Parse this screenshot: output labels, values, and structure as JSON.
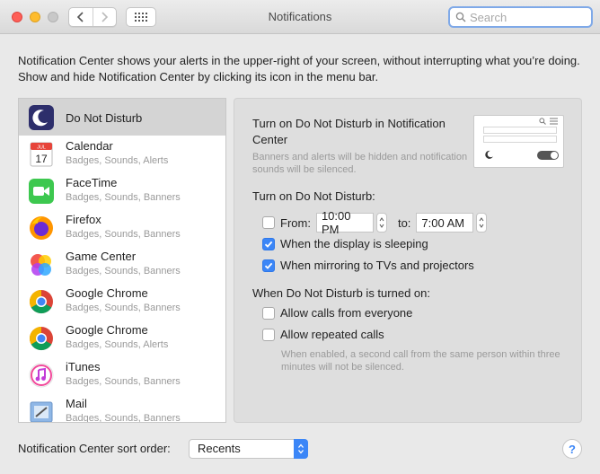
{
  "window": {
    "title": "Notifications"
  },
  "toolbar": {
    "search_placeholder": "Search",
    "search_value": ""
  },
  "description": "Notification Center shows your alerts in the upper-right of your screen, without interrupting what you’re doing. Show and hide Notification Center by clicking its icon in the menu bar.",
  "apps": [
    {
      "name": "Do Not Disturb",
      "sub": "",
      "icon": "moon-icon"
    },
    {
      "name": "Calendar",
      "sub": "Badges, Sounds, Alerts",
      "icon": "calendar-icon"
    },
    {
      "name": "FaceTime",
      "sub": "Badges, Sounds, Banners",
      "icon": "facetime-icon"
    },
    {
      "name": "Firefox",
      "sub": "Badges, Sounds, Banners",
      "icon": "firefox-icon"
    },
    {
      "name": "Game Center",
      "sub": "Badges, Sounds, Banners",
      "icon": "game-center-icon"
    },
    {
      "name": "Google Chrome",
      "sub": "Badges, Sounds, Banners",
      "icon": "chrome-icon"
    },
    {
      "name": "Google Chrome",
      "sub": "Badges, Sounds, Alerts",
      "icon": "chrome-icon"
    },
    {
      "name": "iTunes",
      "sub": "Badges, Sounds, Banners",
      "icon": "itunes-icon"
    },
    {
      "name": "Mail",
      "sub": "Badges, Sounds, Banners",
      "icon": "mail-icon"
    }
  ],
  "calendar_icon": {
    "month": "JUL",
    "day": "17"
  },
  "dnd": {
    "heading": "Turn on Do Not Disturb in Notification Center",
    "note": "Banners and alerts will be hidden and notification sounds will be silenced.",
    "turn_on_label": "Turn on Do Not Disturb:",
    "from_label": "From:",
    "from_value": "10:00 PM",
    "to_label": "to:",
    "to_value": "7:00 AM",
    "from_checked": false,
    "display_sleeping_label": "When the display is sleeping",
    "display_sleeping_checked": true,
    "mirroring_label": "When mirroring to TVs and projectors",
    "mirroring_checked": true,
    "when_on_label": "When Do Not Disturb is turned on:",
    "allow_calls_label": "Allow calls from everyone",
    "allow_calls_checked": false,
    "repeated_calls_label": "Allow repeated calls",
    "repeated_calls_checked": false,
    "repeated_note": "When enabled, a second call from the same person within three minutes will not be silenced."
  },
  "footer": {
    "sort_label": "Notification Center sort order:",
    "sort_value": "Recents",
    "help_label": "?"
  },
  "colors": {
    "accent": "#3b86f7",
    "selection": "#d4d4d4"
  }
}
